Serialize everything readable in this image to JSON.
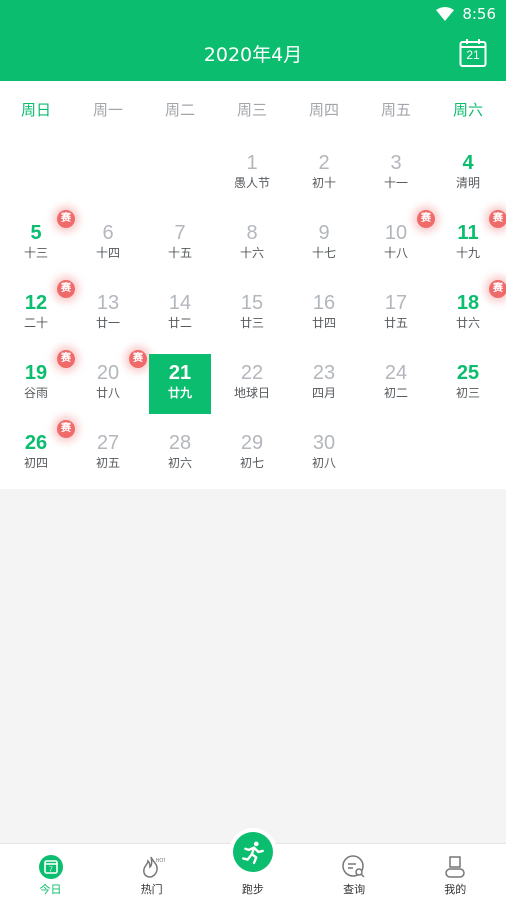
{
  "status_bar": {
    "time": "8:56"
  },
  "header": {
    "title": "2020年4月",
    "calendar_button_day": "21"
  },
  "weekdays": [
    {
      "label": "周日",
      "weekend": true
    },
    {
      "label": "周一",
      "weekend": false
    },
    {
      "label": "周二",
      "weekend": false
    },
    {
      "label": "周三",
      "weekend": false
    },
    {
      "label": "周四",
      "weekend": false
    },
    {
      "label": "周五",
      "weekend": false
    },
    {
      "label": "周六",
      "weekend": true
    }
  ],
  "days": [
    {
      "day": "1",
      "lunar": "愚人节",
      "col": 3,
      "row": 0
    },
    {
      "day": "2",
      "lunar": "初十",
      "col": 4,
      "row": 0
    },
    {
      "day": "3",
      "lunar": "十一",
      "col": 5,
      "row": 0
    },
    {
      "day": "4",
      "lunar": "清明",
      "col": 6,
      "row": 0
    },
    {
      "day": "5",
      "lunar": "十三",
      "col": 0,
      "row": 1,
      "badge": "赛"
    },
    {
      "day": "6",
      "lunar": "十四",
      "col": 1,
      "row": 1
    },
    {
      "day": "7",
      "lunar": "十五",
      "col": 2,
      "row": 1
    },
    {
      "day": "8",
      "lunar": "十六",
      "col": 3,
      "row": 1
    },
    {
      "day": "9",
      "lunar": "十七",
      "col": 4,
      "row": 1
    },
    {
      "day": "10",
      "lunar": "十八",
      "col": 5,
      "row": 1,
      "badge": "赛"
    },
    {
      "day": "11",
      "lunar": "十九",
      "col": 6,
      "row": 1,
      "badge": "赛"
    },
    {
      "day": "12",
      "lunar": "二十",
      "col": 0,
      "row": 2,
      "badge": "赛"
    },
    {
      "day": "13",
      "lunar": "廿一",
      "col": 1,
      "row": 2
    },
    {
      "day": "14",
      "lunar": "廿二",
      "col": 2,
      "row": 2
    },
    {
      "day": "15",
      "lunar": "廿三",
      "col": 3,
      "row": 2
    },
    {
      "day": "16",
      "lunar": "廿四",
      "col": 4,
      "row": 2
    },
    {
      "day": "17",
      "lunar": "廿五",
      "col": 5,
      "row": 2
    },
    {
      "day": "18",
      "lunar": "廿六",
      "col": 6,
      "row": 2,
      "badge": "赛"
    },
    {
      "day": "19",
      "lunar": "谷雨",
      "col": 0,
      "row": 3,
      "badge": "赛"
    },
    {
      "day": "20",
      "lunar": "廿八",
      "col": 1,
      "row": 3,
      "badge": "赛"
    },
    {
      "day": "21",
      "lunar": "廿九",
      "col": 2,
      "row": 3,
      "selected": true
    },
    {
      "day": "22",
      "lunar": "地球日",
      "col": 3,
      "row": 3
    },
    {
      "day": "23",
      "lunar": "四月",
      "col": 4,
      "row": 3
    },
    {
      "day": "24",
      "lunar": "初二",
      "col": 5,
      "row": 3
    },
    {
      "day": "25",
      "lunar": "初三",
      "col": 6,
      "row": 3
    },
    {
      "day": "26",
      "lunar": "初四",
      "col": 0,
      "row": 4,
      "badge": "赛"
    },
    {
      "day": "27",
      "lunar": "初五",
      "col": 1,
      "row": 4
    },
    {
      "day": "28",
      "lunar": "初六",
      "col": 2,
      "row": 4
    },
    {
      "day": "29",
      "lunar": "初七",
      "col": 3,
      "row": 4
    },
    {
      "day": "30",
      "lunar": "初八",
      "col": 4,
      "row": 4
    }
  ],
  "nav": [
    {
      "label": "今日",
      "icon": "calendar-today-icon",
      "active": true
    },
    {
      "label": "热门",
      "icon": "fire-hot-icon",
      "active": false
    },
    {
      "label": "跑步",
      "icon": "running-man-icon",
      "active": false
    },
    {
      "label": "查询",
      "icon": "search-list-icon",
      "active": false
    },
    {
      "label": "我的",
      "icon": "profile-icon",
      "active": false
    }
  ],
  "colors": {
    "accent": "#0bbd6e",
    "badge": "#f06a6a",
    "muted_day": "#b3b7bc"
  }
}
